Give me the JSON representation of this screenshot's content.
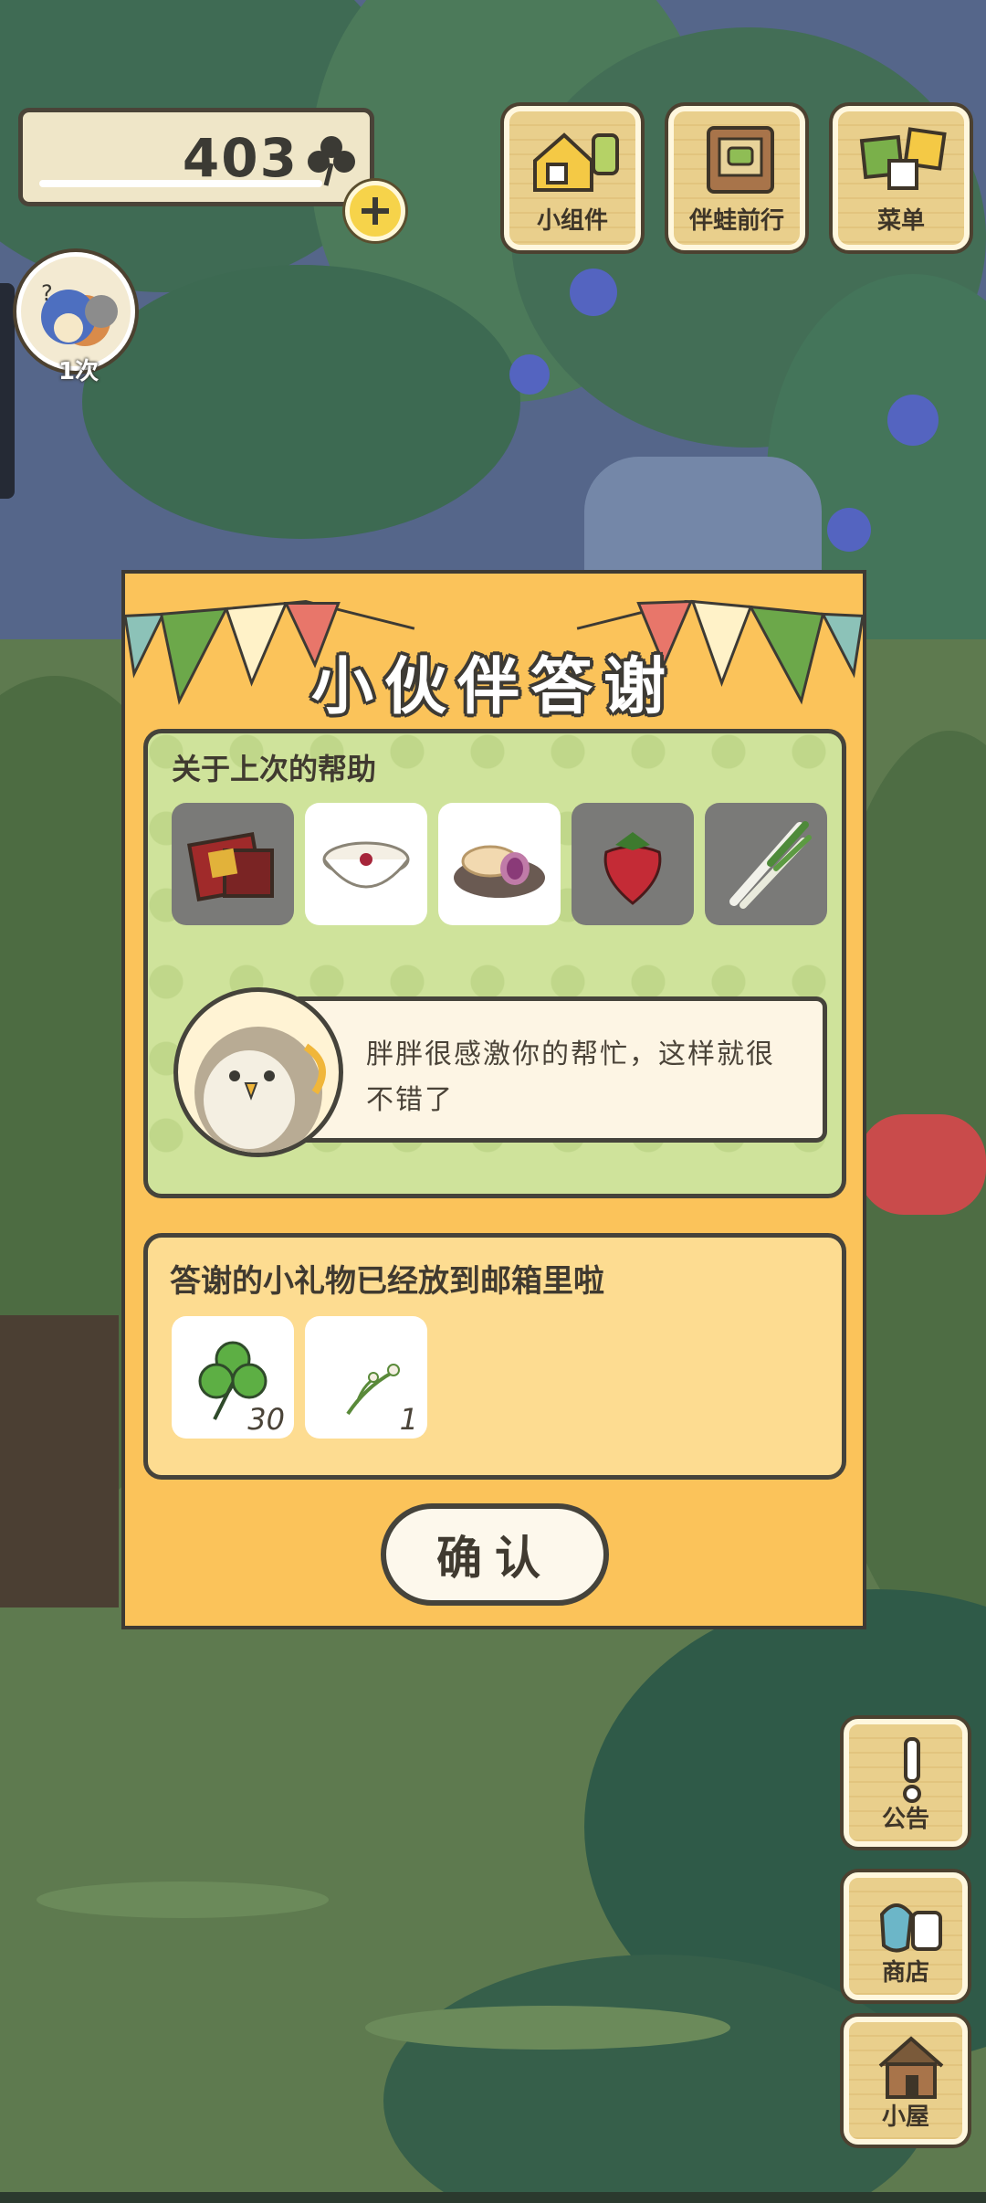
{
  "currency": {
    "value": "403",
    "add_label": "+"
  },
  "top_buttons": [
    {
      "label": "小组件",
      "icon": "widget-icon"
    },
    {
      "label": "伴蛙前行",
      "icon": "journal-icon"
    },
    {
      "label": "菜单",
      "icon": "menu-icon"
    }
  ],
  "visitor": {
    "count_label": "1次"
  },
  "dialog": {
    "title": "小伙伴答谢",
    "help_section": {
      "title": "关于上次的帮助",
      "items": [
        {
          "icon": "mooncake-box-icon",
          "state": "dim"
        },
        {
          "icon": "porridge-bowl-icon",
          "state": "lit"
        },
        {
          "icon": "pastry-plate-icon",
          "state": "lit"
        },
        {
          "icon": "strawberry-icon",
          "state": "dim"
        },
        {
          "icon": "scallion-icon",
          "state": "dim"
        }
      ],
      "speaker_icon": "owl-friend-icon",
      "message": "胖胖很感激你的帮忙，这样就很不错了"
    },
    "gift_section": {
      "title": "答谢的小礼物已经放到邮箱里啦",
      "gifts": [
        {
          "icon": "clover-icon",
          "count": "30"
        },
        {
          "icon": "flower-sprig-icon",
          "count": "1"
        }
      ]
    },
    "confirm_label": "确认"
  },
  "side_buttons": [
    {
      "label": "公告",
      "icon": "exclamation-icon"
    },
    {
      "label": "商店",
      "icon": "shop-bags-icon"
    },
    {
      "label": "小屋",
      "icon": "house-icon"
    }
  ],
  "colors": {
    "dialog_bg": "#fbc35a",
    "help_panel": "#cfe39b",
    "gift_panel": "#fddc91",
    "outline": "#3d3a34"
  }
}
